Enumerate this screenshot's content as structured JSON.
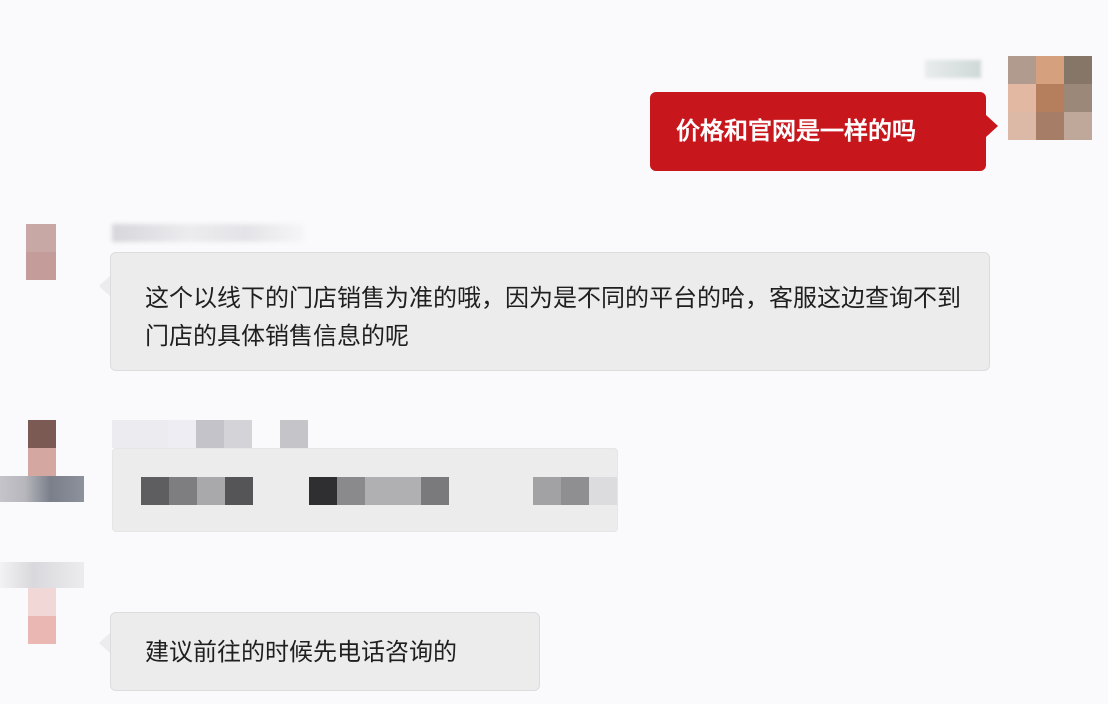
{
  "chat": {
    "messages": [
      {
        "sender": "self",
        "text": "价格和官网是一样的吗"
      },
      {
        "sender": "other",
        "text": "这个以线下的门店销售为准的哦，因为是不同的平台的哈，客服这边查询不到门店的具体销售信息的呢"
      },
      {
        "sender": "other",
        "text": ""
      },
      {
        "sender": "other",
        "text": "建议前往的时候先电话咨询的"
      }
    ]
  },
  "colors": {
    "self_bubble": "#c8161d",
    "other_bubble": "#ececed",
    "background": "#faf9fb"
  },
  "icons": {
    "avatar": "pixelated-avatar"
  }
}
